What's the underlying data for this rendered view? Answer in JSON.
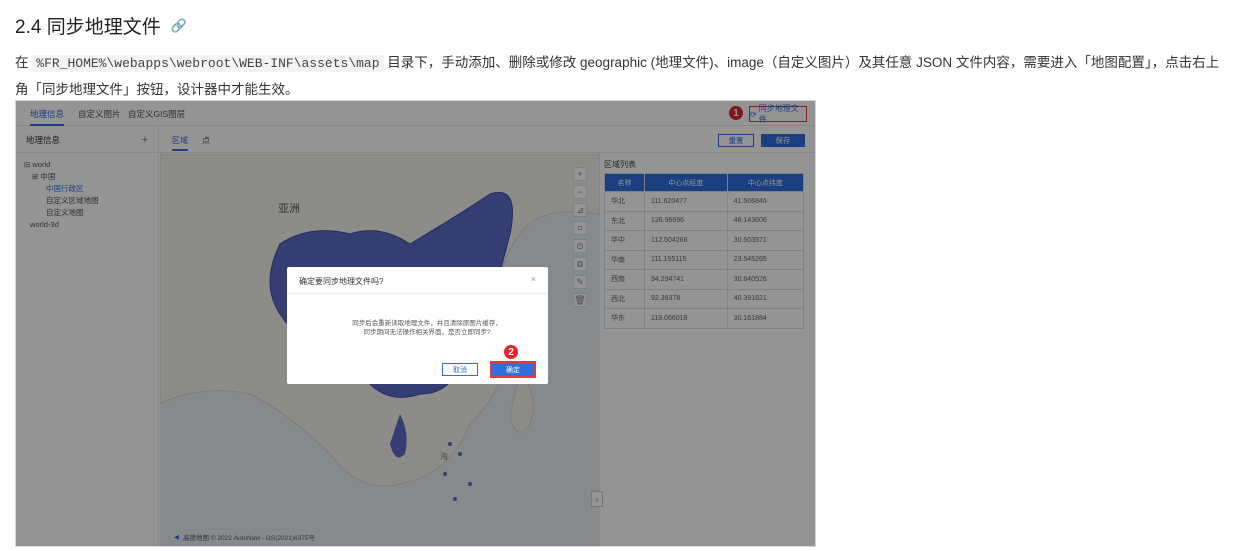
{
  "heading": {
    "title": "2.4 同步地理文件",
    "anchor_icon": "link-icon"
  },
  "paragraph": {
    "pre": "在 ",
    "code": "%FR_HOME%\\webapps\\webroot\\WEB-INF\\assets\\map",
    "post": " 目录下，手动添加、删除或修改 geographic (地理文件)、image（自定义图片）及其任意 JSON 文件内容，需要进入「地图配置」，点击右上角「同步地理文件」按钮，设计器中才能生效。"
  },
  "screenshot": {
    "tabs": [
      "地理信息",
      "自定义图片",
      "自定义GIS图层"
    ],
    "sync_button": "同步地理文件",
    "badge1": "1",
    "badge2": "2",
    "left_panel": {
      "title": "地理信息",
      "add": "+",
      "tree": [
        "⊟ world",
        "⊞ 中国",
        "中国行政区",
        "自定义区域地图",
        "自定义地图",
        "world-3d"
      ]
    },
    "sub_tabs": [
      "区域",
      "点"
    ],
    "reset_button": "重置",
    "save_button": "保存",
    "map_label_asia": "亚洲",
    "map_label_sea": "海",
    "map_tools": [
      "+",
      "−",
      "⊿",
      "⌗",
      "⊙",
      "⧉",
      "✎",
      "🗑"
    ],
    "collapse": "›",
    "region_list": {
      "title": "区域列表",
      "columns": [
        "名称",
        "中心点经度",
        "中心点纬度"
      ],
      "rows": [
        [
          "华北",
          "111.620477",
          "41.506846"
        ],
        [
          "东北",
          "126.96696",
          "46.143606"
        ],
        [
          "华中",
          "112.504266",
          "30.503571"
        ],
        [
          "华南",
          "111.155115",
          "23.545265"
        ],
        [
          "西南",
          "94.294741",
          "30.640526"
        ],
        [
          "西北",
          "92.36378",
          "40.391621"
        ],
        [
          "华东",
          "119.066018",
          "30.161884"
        ]
      ]
    },
    "dialog": {
      "title": "确定要同步地理文件吗?",
      "close": "×",
      "message_line1": "同步后会重新读取地理文件，并且清除原图片缓存，",
      "message_line2": "同步期间无法操作相关界面，是否立即同步?",
      "cancel": "取消",
      "ok": "确定"
    },
    "footer": "高德地图 © 2022 AutoNavi - GS(2021)6375号"
  },
  "colors": {
    "accent": "#2f6fe0",
    "highlight": "#e53935",
    "china": "#5a6cc4"
  }
}
